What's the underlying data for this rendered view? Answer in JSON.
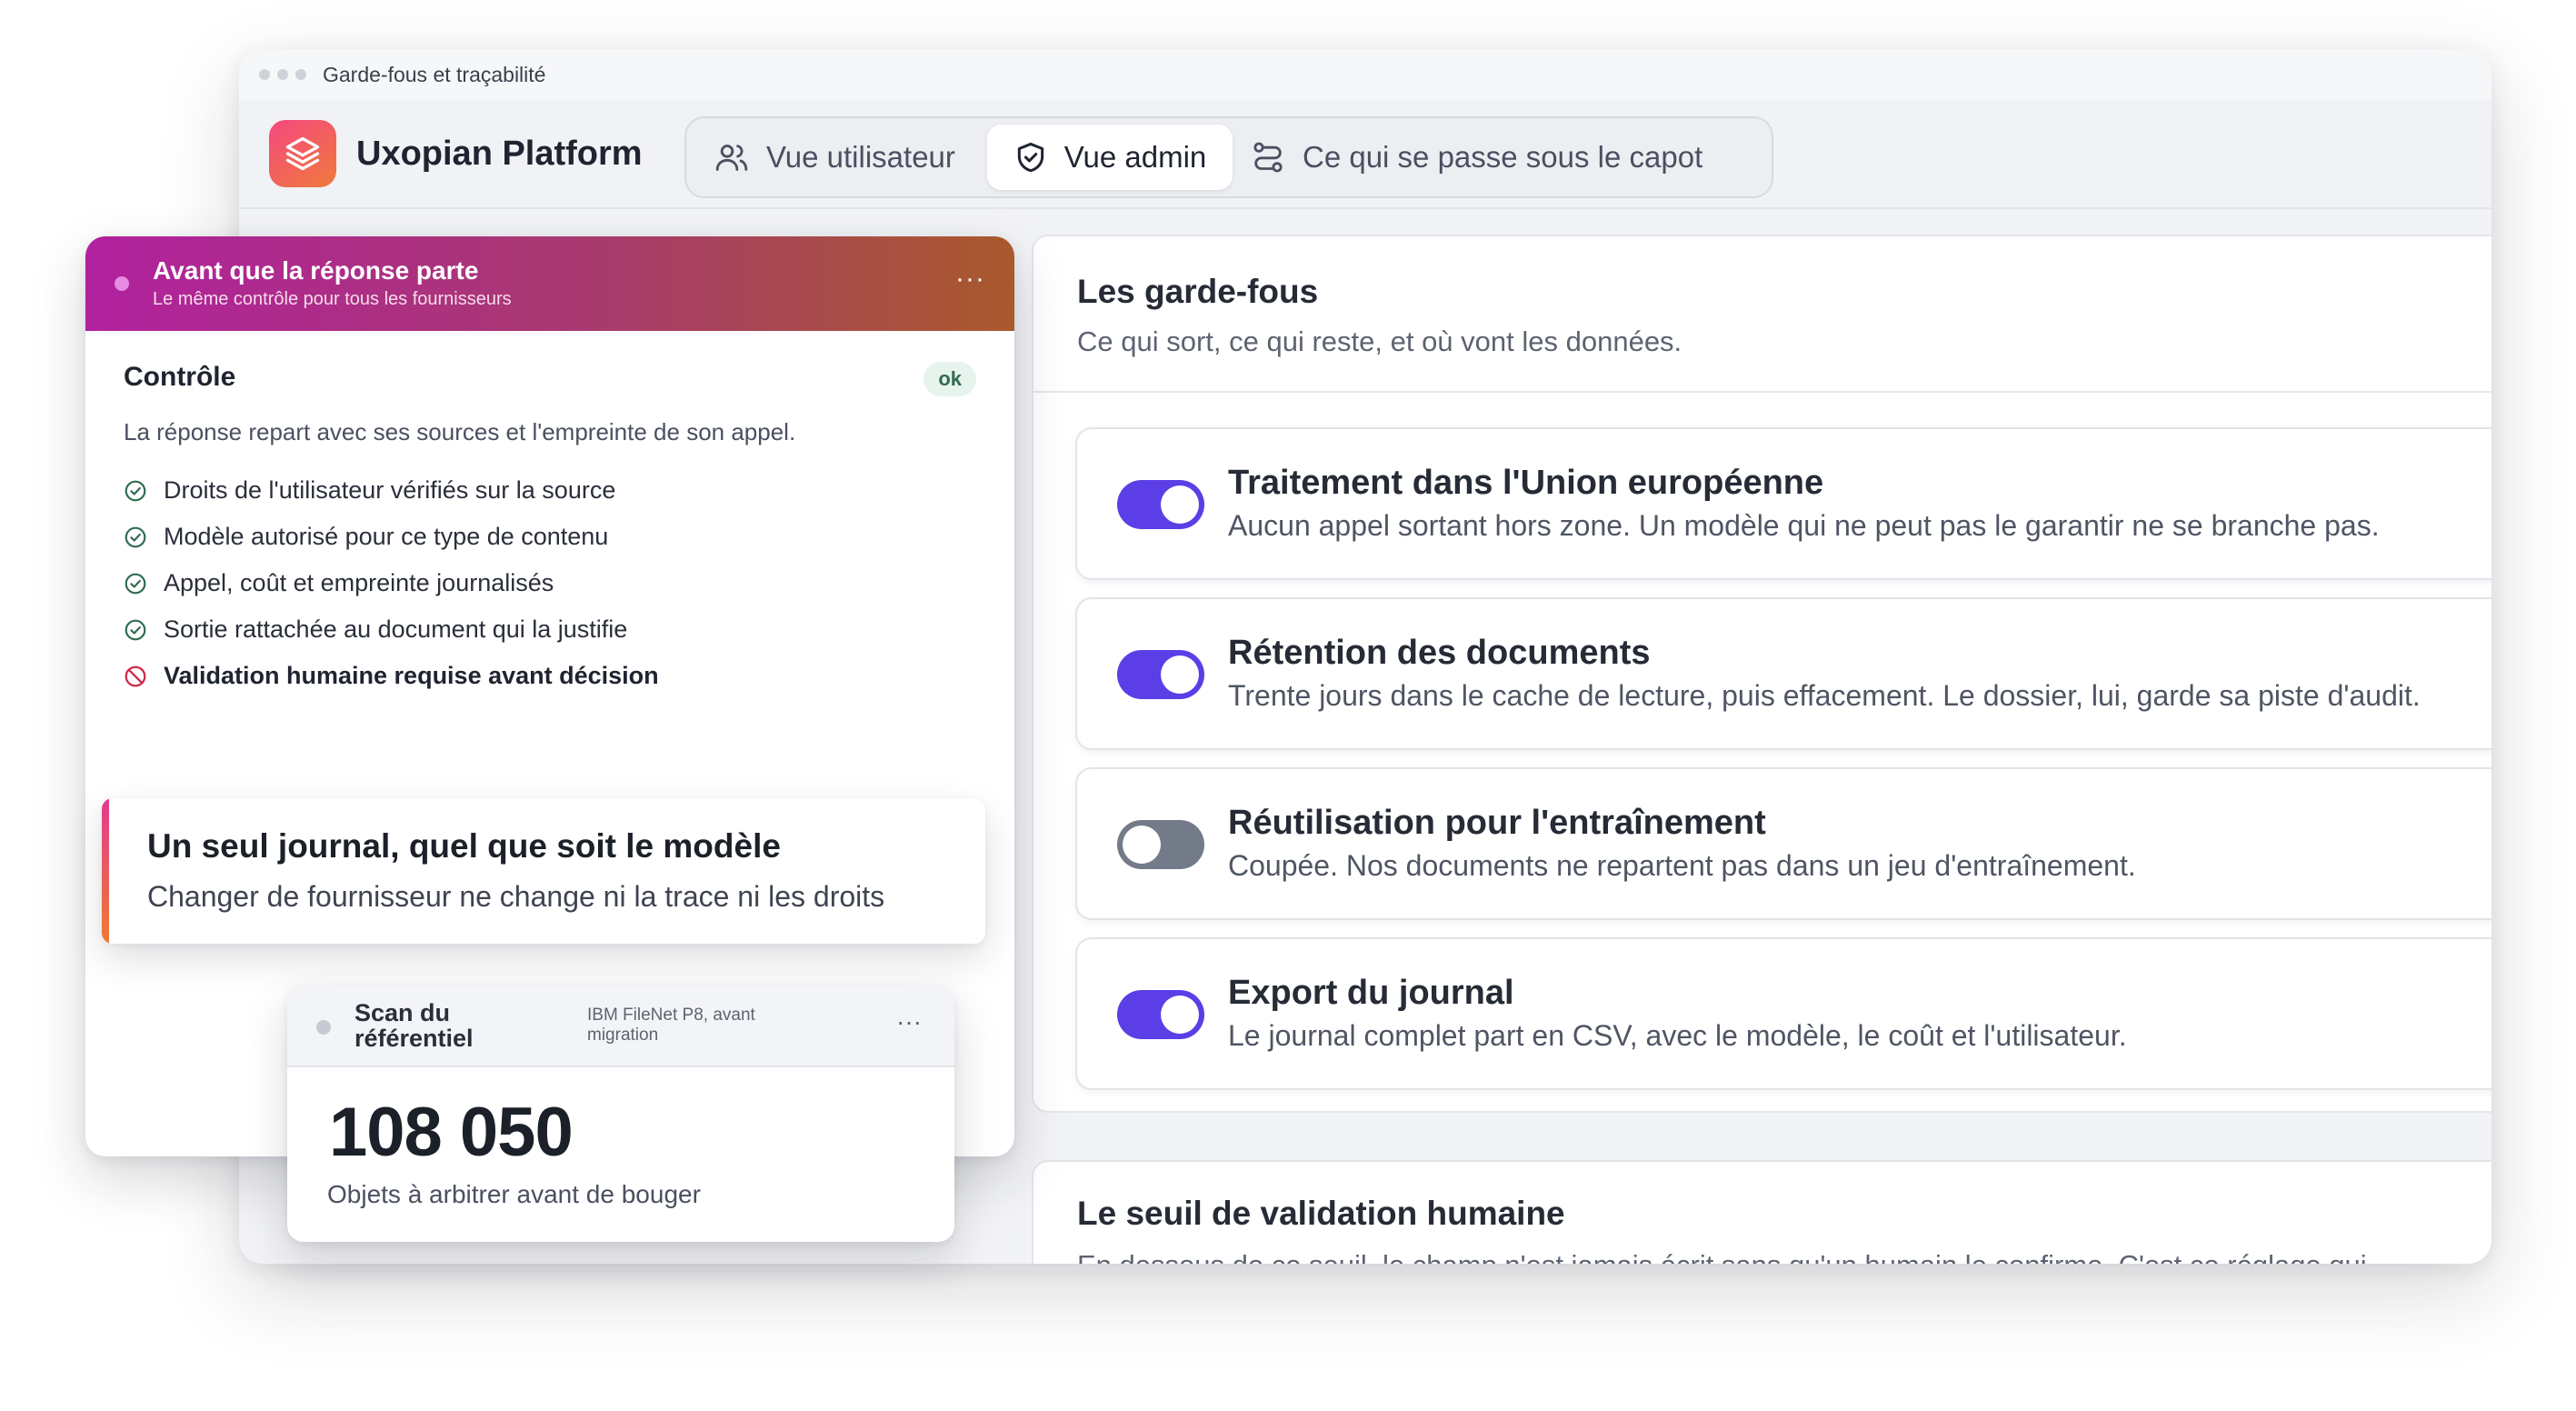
{
  "window": {
    "title": "Garde-fous et traçabilité"
  },
  "app": {
    "brand": "Uxopian Platform",
    "tabs": [
      {
        "label": "Vue utilisateur",
        "icon": "users-icon",
        "active": false
      },
      {
        "label": "Vue admin",
        "icon": "shield-check-icon",
        "active": true
      },
      {
        "label": "Ce qui se passe sous le capot",
        "icon": "route-icon",
        "active": false
      }
    ]
  },
  "guardrails": {
    "title": "Les garde-fous",
    "subtitle": "Ce qui sort, ce qui reste, et où vont les données.",
    "items": [
      {
        "title": "Traitement dans l'Union européenne",
        "description": "Aucun appel sortant hors zone. Un modèle qui ne peut pas le garantir ne se branche pas.",
        "enabled": true
      },
      {
        "title": "Rétention des documents",
        "description": "Trente jours dans le cache de lecture, puis effacement. Le dossier, lui, garde sa piste d'audit.",
        "enabled": true
      },
      {
        "title": "Réutilisation pour l'entraînement",
        "description": "Coupée. Nos documents ne repartent pas dans un jeu d'entraînement.",
        "enabled": false
      },
      {
        "title": "Export du journal",
        "description": "Le journal complet part en CSV, avec le modèle, le coût et l'utilisateur.",
        "enabled": true
      }
    ]
  },
  "threshold": {
    "title": "Le seuil de validation humaine",
    "text": "En dessous de ce seuil, le champ n'est jamais écrit sans qu'un humain le confirme. C'est ce réglage qui"
  },
  "control_card": {
    "header_title": "Avant que la réponse parte",
    "header_subtitle": "Le même contrôle pour tous les fournisseurs",
    "more": "···",
    "title": "Contrôle",
    "badge": "ok",
    "description": "La réponse repart avec ses sources et l'empreinte de son appel.",
    "checks": [
      {
        "label": "Droits de l'utilisateur vérifiés sur la source",
        "status": "ok"
      },
      {
        "label": "Modèle autorisé pour ce type de contenu",
        "status": "ok"
      },
      {
        "label": "Appel, coût et empreinte journalisés",
        "status": "ok"
      },
      {
        "label": "Sortie rattachée au document qui la justifie",
        "status": "ok"
      },
      {
        "label": "Validation humaine requise avant décision",
        "status": "blocked"
      }
    ]
  },
  "callout": {
    "title": "Un seul journal, quel que soit le modèle",
    "text": "Changer de fournisseur ne change ni la trace ni les droits"
  },
  "scan_card": {
    "title": "Scan du référentiel",
    "source": "IBM FileNet P8, avant migration",
    "more": "···",
    "count": "108 050",
    "label": "Objets à arbitrer avant de bouger"
  },
  "colors": {
    "accent": "#5b3ee6",
    "toggle_off": "#737a88",
    "card_gradient_start": "#b1219f",
    "card_gradient_end": "#a9592c",
    "ok_green": "#2f6b4f",
    "deny_red": "#d0284a"
  }
}
